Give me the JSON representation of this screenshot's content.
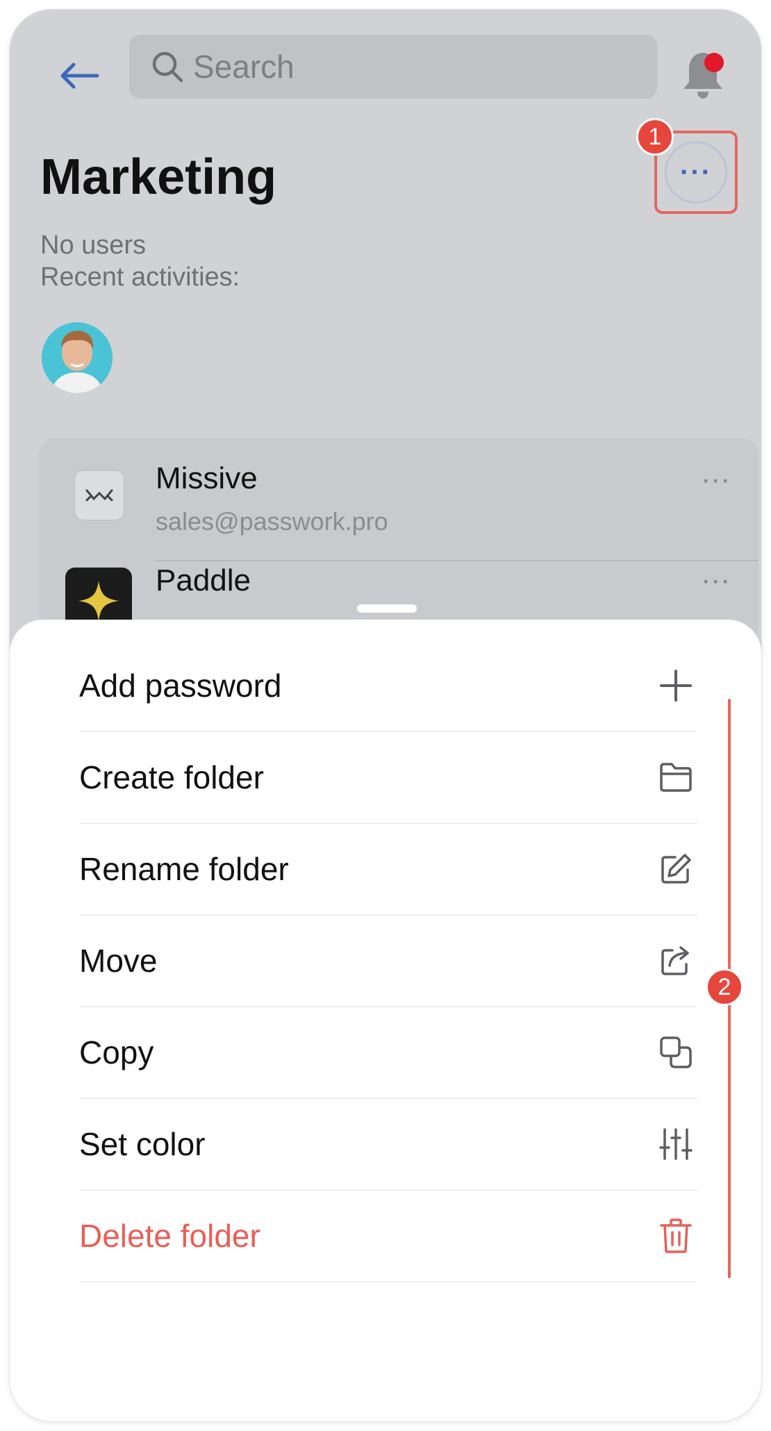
{
  "header": {
    "search_placeholder": "Search"
  },
  "folder": {
    "title": "Marketing",
    "users_text": "No users",
    "recent_label": "Recent activities:"
  },
  "annotations": {
    "badge_1": "1",
    "badge_2": "2"
  },
  "entries": [
    {
      "name": "Missive",
      "email": "sales@passwork.pro",
      "icon": "missive-app-icon"
    },
    {
      "name": "Paddle",
      "email": "",
      "icon": "paddle-app-icon"
    }
  ],
  "menu": {
    "items": [
      {
        "label": "Add password",
        "icon": "plus-icon"
      },
      {
        "label": "Create folder",
        "icon": "folder-icon"
      },
      {
        "label": "Rename folder",
        "icon": "edit-icon"
      },
      {
        "label": "Move",
        "icon": "share-icon"
      },
      {
        "label": "Copy",
        "icon": "copy-icon"
      },
      {
        "label": "Set color",
        "icon": "sliders-icon"
      },
      {
        "label": "Delete folder",
        "icon": "trash-icon"
      }
    ]
  },
  "colors": {
    "accent": "#3a69b8",
    "danger": "#e85f57",
    "notification": "#e1192a",
    "annotation": "#e6463c",
    "dimmed_background": "#d1d2d5"
  }
}
